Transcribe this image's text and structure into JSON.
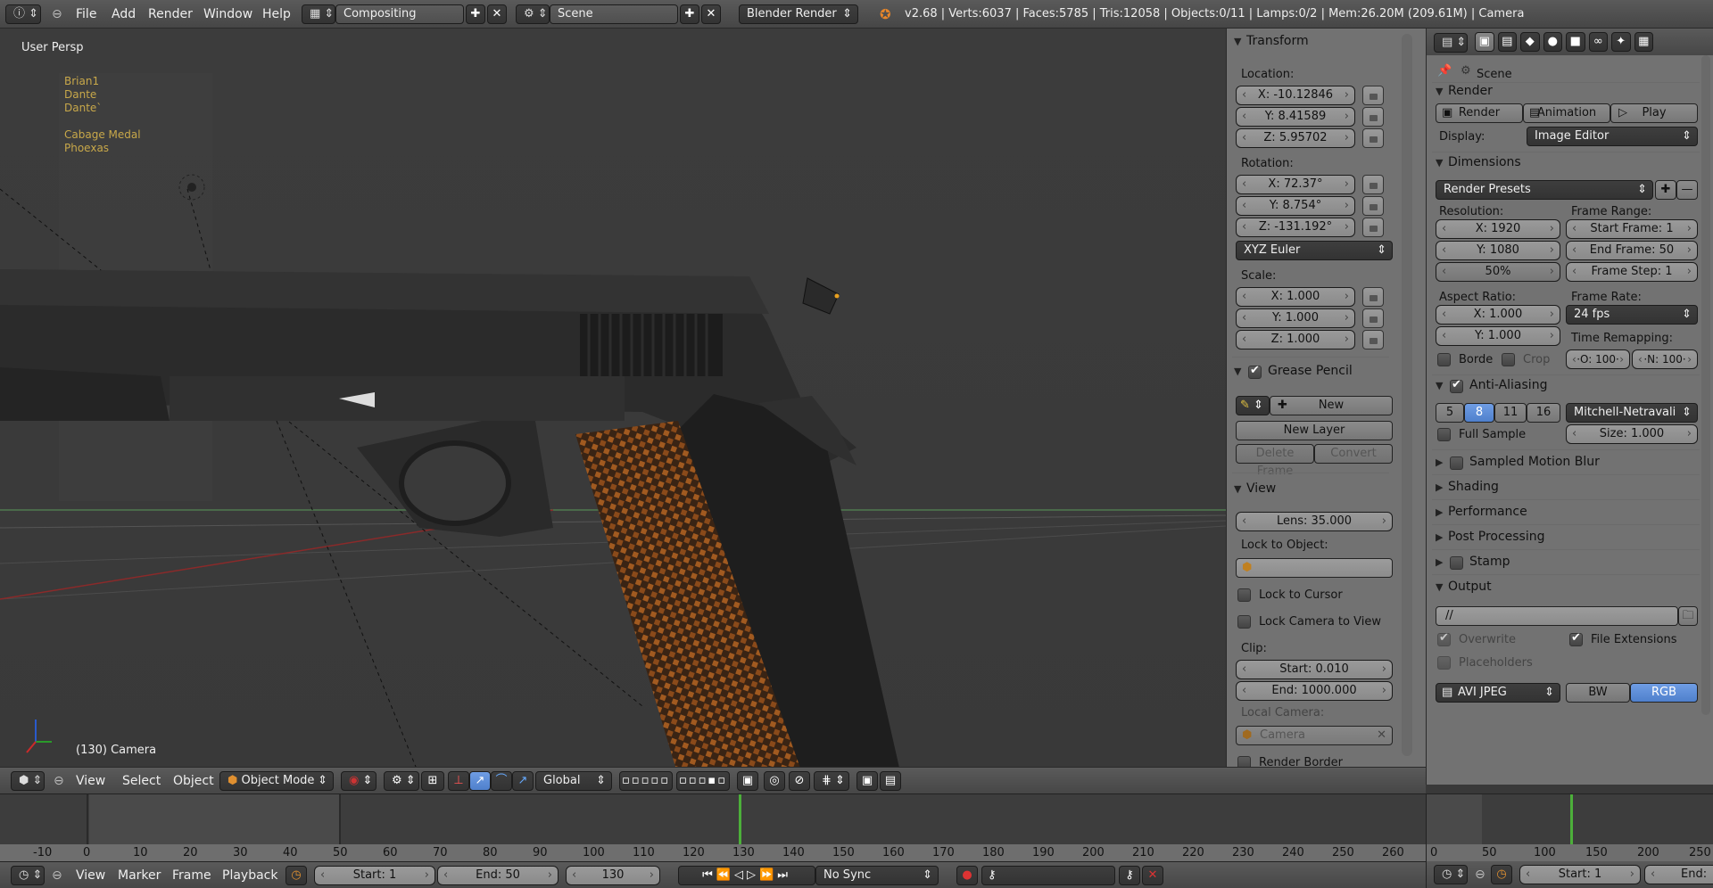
{
  "topbar": {
    "menus": [
      "File",
      "Add",
      "Render",
      "Window",
      "Help"
    ],
    "screen_layout": "Compositing",
    "scene": "Scene",
    "engine": "Blender Render",
    "stats": "v2.68 | Verts:6037 | Faces:5785 | Tris:12058 | Objects:0/11 | Lamps:0/2 | Mem:26.20M (209.61M) | Camera"
  },
  "viewport": {
    "view_name": "User Persp",
    "object_list": [
      "Brian1",
      "Dante",
      "Dante`",
      "",
      "Cabage Medal",
      "Phoexas"
    ],
    "frame_object": "(130) Camera"
  },
  "npanel": {
    "transform_title": "Transform",
    "location_label": "Location:",
    "location": [
      "X: -10.12846",
      "Y: 8.41589",
      "Z: 5.95702"
    ],
    "rotation_label": "Rotation:",
    "rotation": [
      "X: 72.37°",
      "Y: 8.754°",
      "Z: -131.192°"
    ],
    "rotation_mode": "XYZ Euler",
    "scale_label": "Scale:",
    "scale": [
      "X: 1.000",
      "Y: 1.000",
      "Z: 1.000"
    ],
    "grease_title": "Grease Pencil",
    "new_label": "New",
    "new_layer": "New Layer",
    "delete_frame": "Delete Frame",
    "convert": "Convert",
    "view_title": "View",
    "lens": "Lens: 35.000",
    "lock_to_object": "Lock to Object:",
    "lock_cursor": "Lock to Cursor",
    "lock_camera": "Lock Camera to View",
    "clip_label": "Clip:",
    "clip_start": "Start: 0.010",
    "clip_end": "End: 1000.000",
    "local_camera": "Local Camera:",
    "camera": "Camera",
    "render_border": "Render Border"
  },
  "props": {
    "scene": "Scene",
    "render_title": "Render",
    "render_btn": "Render",
    "animation_btn": "Animation",
    "play_btn": "Play",
    "display_label": "Display:",
    "display_value": "Image Editor",
    "dimensions_title": "Dimensions",
    "render_presets": "Render Presets",
    "resolution_label": "Resolution:",
    "res_x": "X: 1920",
    "res_y": "Y: 1080",
    "res_pct": "50%",
    "frame_range_label": "Frame Range:",
    "start_frame": "Start Frame: 1",
    "end_frame": "End Frame: 50",
    "frame_step": "Frame Step: 1",
    "aspect_label": "Aspect Ratio:",
    "aspect_x": "X: 1.000",
    "aspect_y": "Y: 1.000",
    "frame_rate_label": "Frame Rate:",
    "fps": "24 fps",
    "time_remap_label": "Time Remapping:",
    "remap_o": "·O: 100·",
    "remap_n": "·N: 100·",
    "border": "Borde",
    "crop": "Crop",
    "aa_title": "Anti-Aliasing",
    "aa_samples": [
      "5",
      "8",
      "11",
      "16"
    ],
    "aa_filter": "Mitchell-Netravali",
    "full_sample": "Full Sample",
    "aa_size": "Size: 1.000",
    "sampled_motion_blur": "Sampled Motion Blur",
    "shading": "Shading",
    "performance": "Performance",
    "post_processing": "Post Processing",
    "stamp": "Stamp",
    "output": "Output",
    "output_path": "//",
    "overwrite": "Overwrite",
    "file_extensions": "File Extensions",
    "placeholders": "Placeholders",
    "file_format": "AVI JPEG",
    "bw": "BW",
    "rgb": "RGB"
  },
  "viewport_header": {
    "menus": [
      "View",
      "Select",
      "Object"
    ],
    "mode": "Object Mode",
    "orientation": "Global"
  },
  "timeline": {
    "ticks": [
      "-10",
      "0",
      "10",
      "20",
      "30",
      "40",
      "50",
      "60",
      "70",
      "80",
      "90",
      "100",
      "110",
      "120",
      "130",
      "140",
      "150",
      "160",
      "170",
      "180",
      "190",
      "200",
      "210",
      "220",
      "230",
      "240",
      "250",
      "260"
    ],
    "current_frame_value": 130,
    "menus": [
      "View",
      "Marker",
      "Frame",
      "Playback"
    ],
    "start": "Start: 1",
    "end": "End: 50",
    "frame": "130",
    "sync": "No Sync",
    "ticks2": [
      "0",
      "50",
      "100",
      "150",
      "200",
      "250"
    ],
    "start2": "Start: 1",
    "end2": "End:"
  }
}
